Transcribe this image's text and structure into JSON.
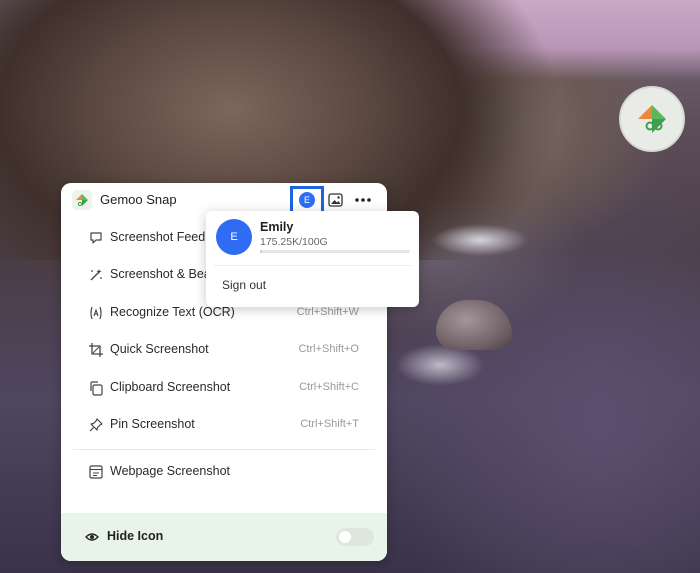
{
  "app": {
    "name": "Gemoo Snap"
  },
  "header": {
    "avatar_initial": "E"
  },
  "menu": {
    "items": [
      {
        "label": "Screenshot Feedb",
        "shortcut": "",
        "icon": "feedback-icon"
      },
      {
        "label": "Screenshot & Bea",
        "shortcut": "",
        "icon": "beautify-icon"
      },
      {
        "label": "Recognize Text (OCR)",
        "shortcut": "Ctrl+Shift+W",
        "icon": "ocr-icon"
      },
      {
        "label": "Quick Screenshot",
        "shortcut": "Ctrl+Shift+O",
        "icon": "crop-icon"
      },
      {
        "label": "Clipboard Screenshot",
        "shortcut": "Ctrl+Shift+C",
        "icon": "clipboard-icon"
      },
      {
        "label": "Pin Screenshot",
        "shortcut": "Ctrl+Shift+T",
        "icon": "pin-icon"
      },
      {
        "label": "Webpage Screenshot",
        "shortcut": "",
        "icon": "webpage-icon"
      }
    ]
  },
  "footer": {
    "hide_icon_label": "Hide Icon",
    "toggle_on": false
  },
  "account_popup": {
    "avatar_initial": "E",
    "user_name": "Emily",
    "quota": "175.25K/100G",
    "usage_fraction": 0.002,
    "sign_out": "Sign out"
  },
  "colors": {
    "accent": "#2E6FF2",
    "highlight_border": "#1F63E0",
    "footer_bg": "#E9F4E8"
  }
}
